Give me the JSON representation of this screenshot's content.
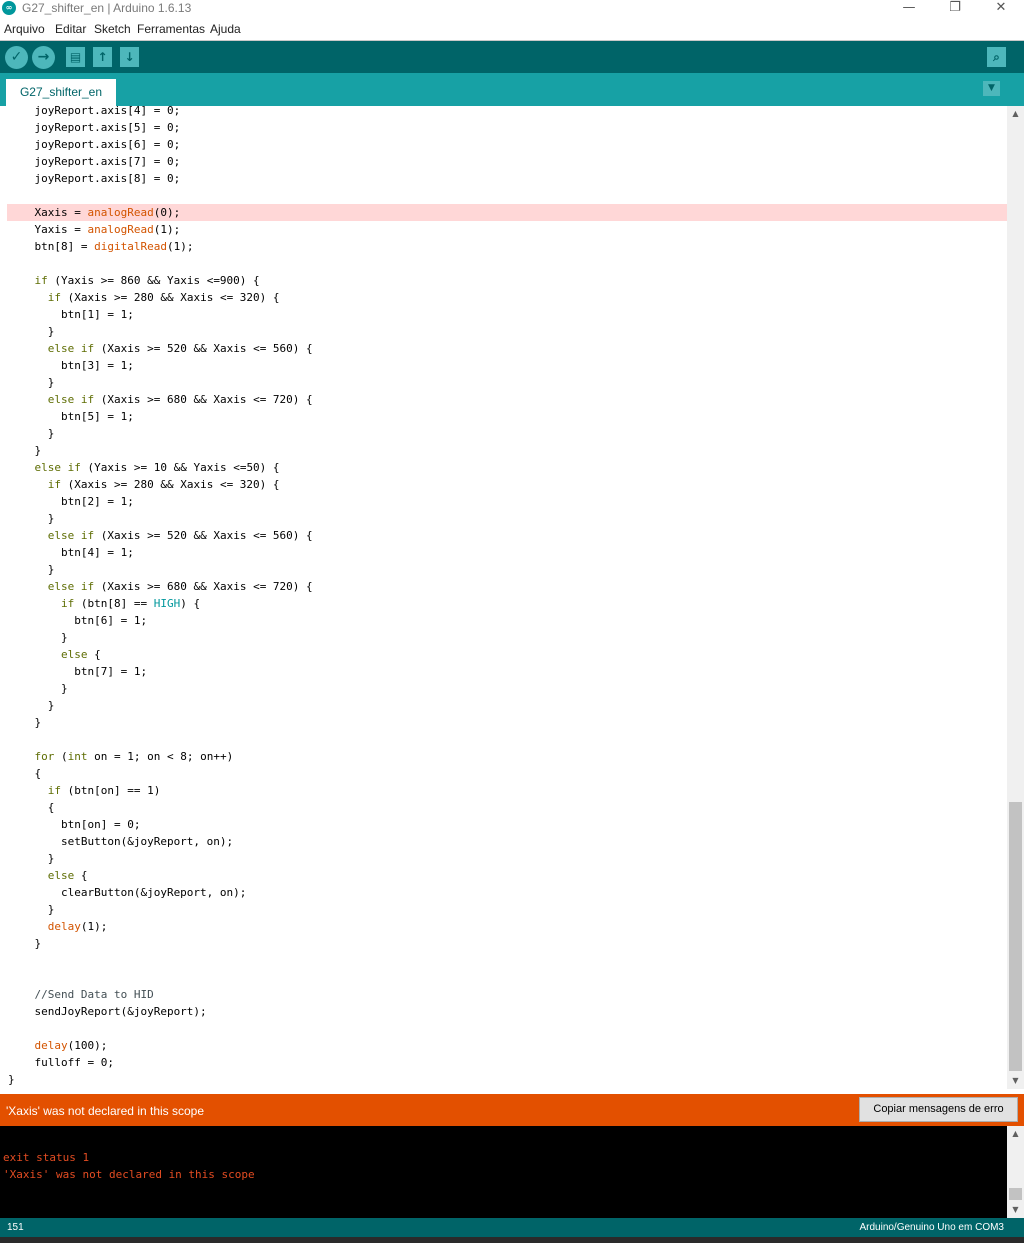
{
  "window": {
    "title": "G27_shifter_en | Arduino 1.6.13",
    "minimize": "—",
    "restore": "❐",
    "close": "✕"
  },
  "menu": {
    "items": [
      "Arquivo",
      "Editar",
      "Sketch",
      "Ferramentas",
      "Ajuda"
    ]
  },
  "toolbar": {
    "verify_icon": "✓",
    "upload_icon": "→",
    "new_icon": "▤",
    "open_icon": "↑",
    "save_icon": "↓",
    "serial_icon": "⌕"
  },
  "tabs": {
    "active": "G27_shifter_en",
    "menu_icon": "▼"
  },
  "code": {
    "lines": [
      "    joyReport.axis[4] = 0;",
      "    joyReport.axis[5] = 0;",
      "    joyReport.axis[6] = 0;",
      "    joyReport.axis[7] = 0;",
      "    joyReport.axis[8] = 0;",
      "",
      "    Xaxis = analogRead(0);",
      "    Yaxis = analogRead(1);",
      "    btn[8] = digitalRead(1);",
      "",
      "    if (Yaxis >= 860 && Yaxis <=900) {",
      "      if (Xaxis >= 280 && Xaxis <= 320) {",
      "        btn[1] = 1;",
      "      }",
      "      else if (Xaxis >= 520 && Xaxis <= 560) {",
      "        btn[3] = 1;",
      "      }",
      "      else if (Xaxis >= 680 && Xaxis <= 720) {",
      "        btn[5] = 1;",
      "      }",
      "    }",
      "    else if (Yaxis >= 10 && Yaxis <=50) {",
      "      if (Xaxis >= 280 && Xaxis <= 320) {",
      "        btn[2] = 1;",
      "      }",
      "      else if (Xaxis >= 520 && Xaxis <= 560) {",
      "        btn[4] = 1;",
      "      }",
      "      else if (Xaxis >= 680 && Xaxis <= 720) {",
      "        if (btn[8] == HIGH) {",
      "          btn[6] = 1;",
      "        }",
      "        else {",
      "          btn[7] = 1;",
      "        }",
      "      }",
      "    }",
      "",
      "    for (int on = 1; on < 8; on++)",
      "    {",
      "      if (btn[on] == 1)",
      "      {",
      "        btn[on] = 0;",
      "        setButton(&joyReport, on);",
      "      }",
      "      else {",
      "        clearButton(&joyReport, on);",
      "      }",
      "      delay(1);",
      "    }",
      "",
      "",
      "    //Send Data to HID",
      "    sendJoyReport(&joyReport);",
      "",
      "    delay(100);",
      "    fulloff = 0;",
      "}"
    ],
    "error_line": 6
  },
  "error_bar": {
    "message": "'Xaxis' was not declared in this scope",
    "copy_button": "Copiar mensagens de erro"
  },
  "console": {
    "lines": [
      "exit status 1",
      "'Xaxis' was not declared in this scope"
    ]
  },
  "status": {
    "line": "151",
    "board": "Arduino/Genuino Uno em COM3"
  },
  "colors": {
    "toolbar": "#006468",
    "tabbar": "#17a1a5",
    "error_bar": "#e35000",
    "error_line_bg": "#ffd7d7",
    "keyword": "#5e6d03",
    "function": "#d35400",
    "constant": "#00979c"
  }
}
